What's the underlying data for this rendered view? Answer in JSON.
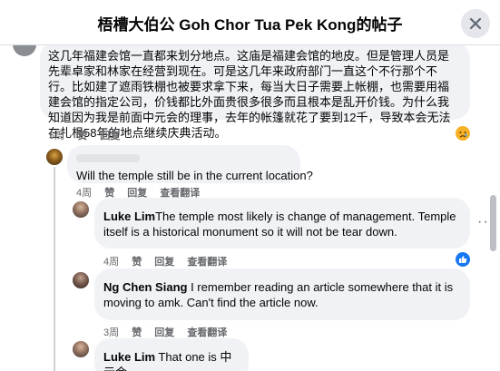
{
  "header": {
    "title": "梧槽大伯公 Goh Chor Tua Pek Kong的帖子"
  },
  "comments": [
    {
      "text": "这几年福建会馆一直都来划分地点。这庙是福建会馆的地皮。但是管理人员是先辈卓家和林家在经营到现在。可是这几年来政府部门一直这个不行那个不行。比如建了遮雨铁棚也被要求拿下来，每当大日子需要上帐棚，也需要用福建会馆的指定公司，价钱都比外面贵很多很多而且根本是乱开价钱。为什么我知道因为我是前面中元会的理事，去年的帐篷就花了要到12千，导致本会无法在扎根58年的地点继续庆典活动。",
      "time": "5周",
      "like": "赞",
      "reply": "回复",
      "reaction_icon": "sad-emoji"
    },
    {
      "text": "Will the temple still be in the current location?",
      "time": "4周",
      "like": "赞",
      "reply": "回复",
      "translate": "查看翻译"
    },
    {
      "author": "Luke Lim",
      "text": "The temple most likely is change of management. Temple itself is a historical monument so it will not be tear down.",
      "time": "4周",
      "like": "赞",
      "reply": "回复",
      "translate": "查看翻译",
      "reaction_icon": "like-icon"
    },
    {
      "author": "Ng Chen Siang",
      "text": "I remember reading an article somewhere that it is moving to amk. Can't find the article now.",
      "time": "3周",
      "like": "赞",
      "reply": "回复",
      "translate": "查看翻译"
    },
    {
      "author": "Luke Lim",
      "text": "That one is 中元会"
    }
  ],
  "colors": {
    "bubble": "#f0f2f5",
    "meta": "#65676b",
    "like_blue": "#1877f2"
  }
}
